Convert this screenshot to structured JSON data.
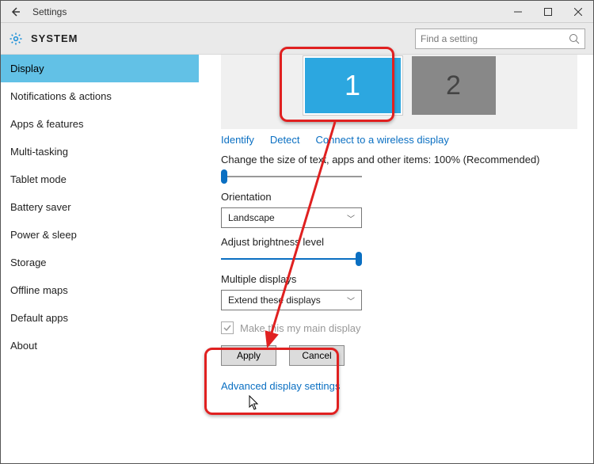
{
  "window": {
    "title": "Settings"
  },
  "header": {
    "section": "SYSTEM",
    "search_placeholder": "Find a setting"
  },
  "sidebar": {
    "items": [
      {
        "label": "Display",
        "active": true
      },
      {
        "label": "Notifications & actions"
      },
      {
        "label": "Apps & features"
      },
      {
        "label": "Multi-tasking"
      },
      {
        "label": "Tablet mode"
      },
      {
        "label": "Battery saver"
      },
      {
        "label": "Power & sleep"
      },
      {
        "label": "Storage"
      },
      {
        "label": "Offline maps"
      },
      {
        "label": "Default apps"
      },
      {
        "label": "About"
      }
    ]
  },
  "main": {
    "display1": "1",
    "display2": "2",
    "links": {
      "identify": "Identify",
      "detect": "Detect",
      "wireless": "Connect to a wireless display"
    },
    "scale_label": "Change the size of text, apps and other items: 100% (Recommended)",
    "orientation_label": "Orientation",
    "orientation_value": "Landscape",
    "brightness_label": "Adjust brightness level",
    "multiple_label": "Multiple displays",
    "multiple_value": "Extend these displays",
    "main_display_label": "Make this my main display",
    "apply": "Apply",
    "cancel": "Cancel",
    "advanced": "Advanced display settings"
  }
}
